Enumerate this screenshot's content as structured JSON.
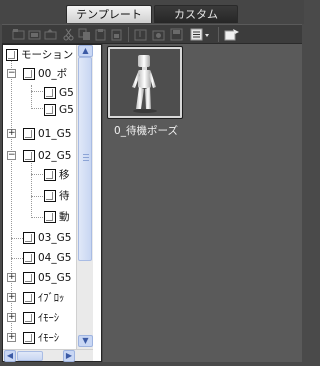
{
  "tabs": [
    {
      "label": "テンプレート",
      "active": true
    },
    {
      "label": "カスタム",
      "active": false
    }
  ],
  "toolbar": {
    "icons": [
      "new-folder-icon",
      "open-folder-icon",
      "folder-up-icon",
      "cut-icon",
      "copy-icon",
      "paste-icon",
      "paste-alt-icon",
      "import-icon",
      "export-icon",
      "save-icon",
      "view-menu-icon",
      "add-item-icon"
    ]
  },
  "tree": {
    "rows": [
      {
        "label": "モーション",
        "expander": "none"
      },
      {
        "label": "00_ポ",
        "expander": "−"
      },
      {
        "label": "G5",
        "expander": "none"
      },
      {
        "label": "G5",
        "expander": "none"
      },
      {
        "label": "01_G5",
        "expander": "+"
      },
      {
        "label": "02_G5",
        "expander": "−"
      },
      {
        "label": "移",
        "expander": "none"
      },
      {
        "label": "待",
        "expander": "none"
      },
      {
        "label": "動",
        "expander": "none"
      },
      {
        "label": "03_G5",
        "expander": "none"
      },
      {
        "label": "04_G5",
        "expander": "none"
      },
      {
        "label": "05_G5",
        "expander": "+"
      },
      {
        "label": "ｲﾌﾞﾛｯ",
        "expander": "+"
      },
      {
        "label": "ｲﾓｰｼ",
        "expander": "+"
      },
      {
        "label": "ｲﾓｰｼ",
        "expander": "+"
      }
    ]
  },
  "items": [
    {
      "caption": "0_待機ポーズ",
      "icon": "figure-icon"
    }
  ],
  "colors": {
    "panel_bg": "#4a4a4a",
    "tree_bg": "#ffffff",
    "scroll_thumb": "#c8d6f2",
    "active_tab": "#e8e8e8"
  }
}
